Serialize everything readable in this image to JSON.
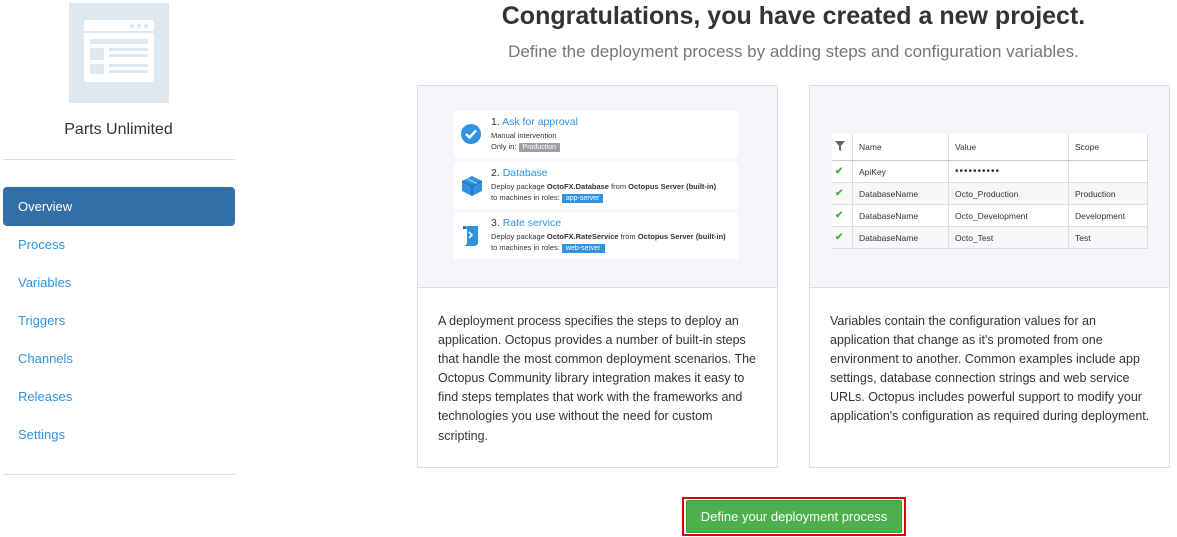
{
  "project": {
    "name": "Parts Unlimited"
  },
  "nav": {
    "items": [
      {
        "label": "Overview",
        "active": true
      },
      {
        "label": "Process"
      },
      {
        "label": "Variables"
      },
      {
        "label": "Triggers"
      },
      {
        "label": "Channels"
      },
      {
        "label": "Releases"
      },
      {
        "label": "Settings"
      }
    ]
  },
  "main": {
    "title": "Congratulations, you have created a new project.",
    "subtitle": "Define the deployment process by adding steps and configuration variables."
  },
  "process_card": {
    "steps": [
      {
        "num": "1.",
        "name": "Ask for approval",
        "line2": "Manual intervention",
        "line3_prefix": "Only in:",
        "tag": "Production",
        "icon": "check-circle-icon"
      },
      {
        "num": "2.",
        "name": "Database",
        "line2_prefix": "Deploy package ",
        "package": "OctoFX.Database",
        "line2_mid": " from ",
        "feed": "Octopus Server (built-in)",
        "line3_prefix": "to machines in roles:",
        "tag": "app-server",
        "icon": "package-icon"
      },
      {
        "num": "3.",
        "name": "Rate service",
        "line2_prefix": "Deploy package ",
        "package": "OctoFX.RateService",
        "line2_mid": " from ",
        "feed": "Octopus Server (built-in)",
        "line3_prefix": "to machines in roles:",
        "tag": "web-server",
        "icon": "script-icon"
      }
    ],
    "text": "A deployment process specifies the steps to deploy an application. Octopus provides a number of built-in steps that handle the most common deployment scenarios. The Octopus Community library integration makes it easy to find steps templates that work with the frameworks and technologies you use without the need for custom scripting."
  },
  "variables_card": {
    "headers": [
      "Name",
      "Value",
      "Scope"
    ],
    "rows": [
      {
        "name": "ApiKey",
        "value": "••••••••••",
        "scope": ""
      },
      {
        "name": "DatabaseName",
        "value": "Octo_Production",
        "scope": "Production"
      },
      {
        "name": "DatabaseName",
        "value": "Octo_Development",
        "scope": "Development"
      },
      {
        "name": "DatabaseName",
        "value": "Octo_Test",
        "scope": "Test"
      }
    ],
    "text": "Variables contain the configuration values for an application that change as it's promoted from one environment to another. Common examples include app settings, database connection strings and web service URLs. Octopus includes powerful support to modify your application's configuration as required during deployment."
  },
  "cta": {
    "label": "Define your deployment process"
  },
  "colors": {
    "accent": "#336fa6",
    "link": "#2f93e0",
    "success": "#4cb04d",
    "highlight": "#dd0000"
  }
}
